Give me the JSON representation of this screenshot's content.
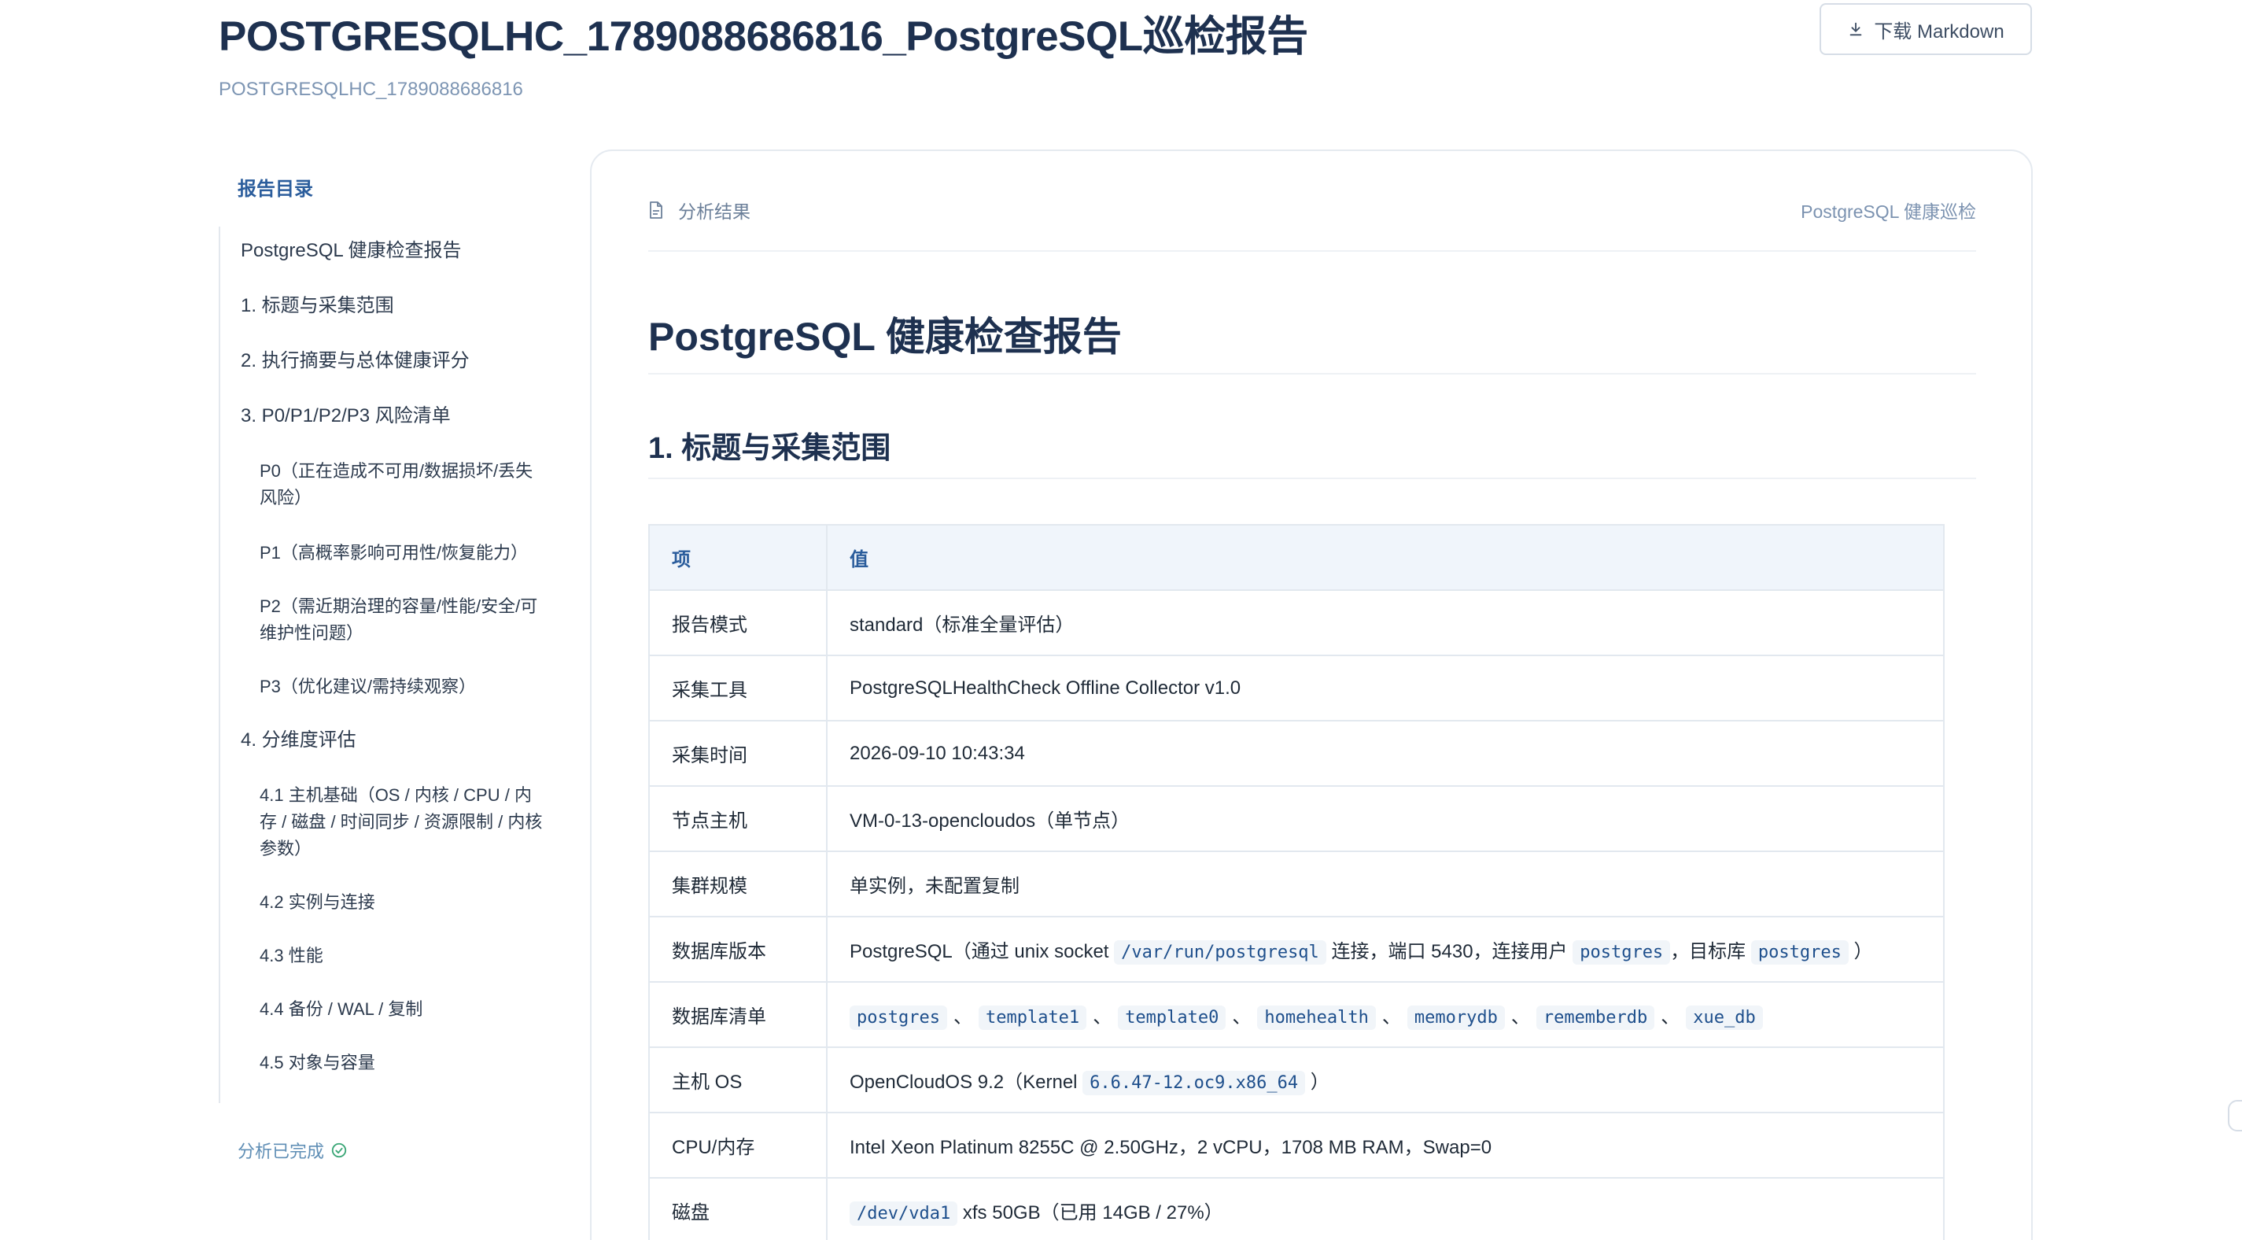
{
  "header": {
    "title": "POSTGRESQLHC_1789088686816_PostgreSQL巡检报告",
    "subtitle": "POSTGRESQLHC_1789088686816",
    "download_label": "下载 Markdown"
  },
  "toc": {
    "title": "报告目录",
    "items": [
      {
        "label": "PostgreSQL 健康检查报告",
        "level": 1
      },
      {
        "label": "1. 标题与采集范围",
        "level": 1
      },
      {
        "label": "2. 执行摘要与总体健康评分",
        "level": 1
      },
      {
        "label": "3. P0/P1/P2/P3 风险清单",
        "level": 1
      },
      {
        "label": "P0（正在造成不可用/数据损坏/丢失风险）",
        "level": 2
      },
      {
        "label": "P1（高概率影响可用性/恢复能力）",
        "level": 2
      },
      {
        "label": "P2（需近期治理的容量/性能/安全/可维护性问题）",
        "level": 2
      },
      {
        "label": "P3（优化建议/需持续观察）",
        "level": 2
      },
      {
        "label": "4. 分维度评估",
        "level": 1
      },
      {
        "label": "4.1 主机基础（OS / 内核 / CPU / 内存 / 磁盘 / 时间同步 / 资源限制 / 内核参数）",
        "level": 2
      },
      {
        "label": "4.2 实例与连接",
        "level": 2
      },
      {
        "label": "4.3 性能",
        "level": 2
      },
      {
        "label": "4.4 备份 / WAL / 复制",
        "level": 2
      },
      {
        "label": "4.5 对象与容量",
        "level": 2
      }
    ],
    "status": "分析已完成"
  },
  "card": {
    "tab_label": "分析结果",
    "right_label": "PostgreSQL 健康巡检"
  },
  "doc": {
    "h1": "PostgreSQL 健康检查报告",
    "h2": "1. 标题与采集范围",
    "table": {
      "headers": [
        "项",
        "值"
      ],
      "rows": {
        "mode": {
          "key": "报告模式",
          "value": "standard（标准全量评估）"
        },
        "tool": {
          "key": "采集工具",
          "value": "PostgreSQLHealthCheck Offline Collector v1.0"
        },
        "time": {
          "key": "采集时间",
          "value": "2026-09-10 10:43:34"
        },
        "host": {
          "key": "节点主机",
          "value": "VM-0-13-opencloudos（单节点）"
        },
        "cluster": {
          "key": "集群规模",
          "value": "单实例，未配置复制"
        },
        "version": {
          "key": "数据库版本",
          "t1": "PostgreSQL（通过 unix socket",
          "c1": "/var/run/postgresql",
          "t2": "连接，端口 5430，连接用户",
          "c2": "postgres",
          "t3": "，目标库",
          "c3": "postgres",
          "t4": "）"
        },
        "dblist": {
          "key": "数据库清单",
          "dbs": [
            "postgres",
            "template1",
            "template0",
            "homehealth",
            "memorydb",
            "rememberdb",
            "xue_db"
          ],
          "sep": "、"
        },
        "os": {
          "key": "主机 OS",
          "t1": "OpenCloudOS 9.2（Kernel",
          "c1": "6.6.47-12.oc9.x86_64",
          "t2": "）"
        },
        "cpu": {
          "key": "CPU/内存",
          "value": "Intel Xeon Platinum 8255C @ 2.50GHz，2 vCPU，1708 MB RAM，Swap=0"
        },
        "disk": {
          "key": "磁盘",
          "c1": "/dev/vda1",
          "t1": "xfs 50GB（已用 14GB / 27%）"
        }
      }
    }
  }
}
